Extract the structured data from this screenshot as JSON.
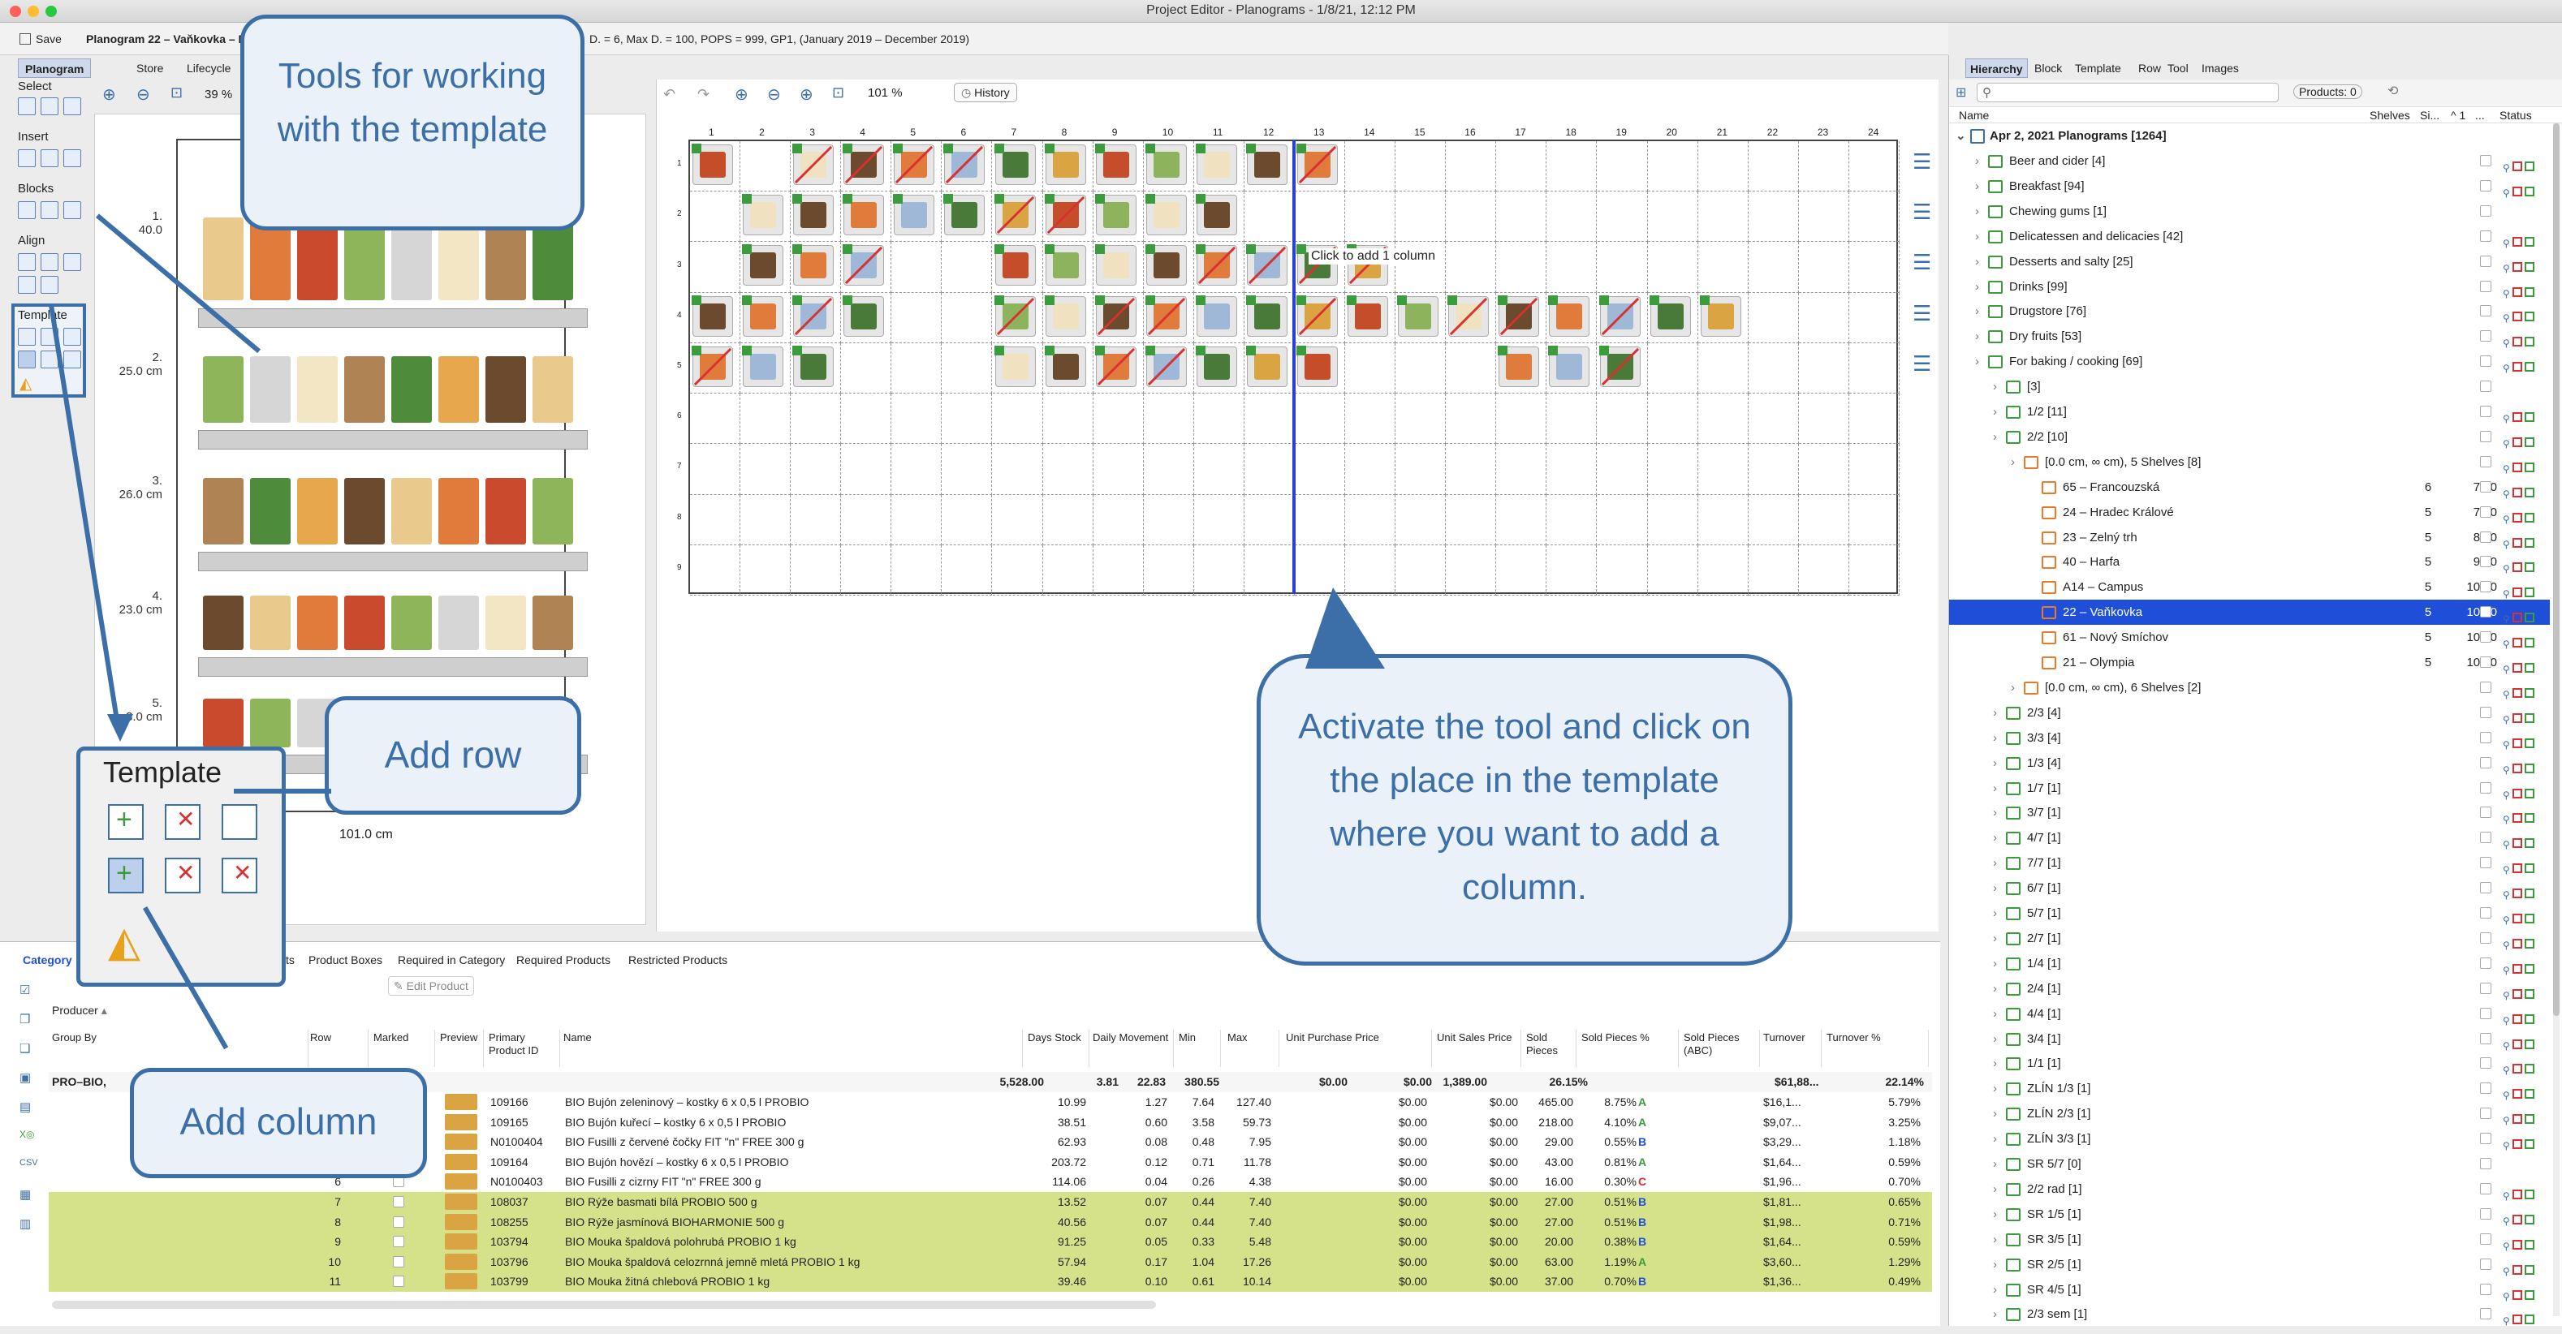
{
  "window": {
    "title": "Project Editor - Planograms - 1/8/21, 12:12 PM"
  },
  "toolbar": {
    "save_label": "Save",
    "planogram_info": "Planogram 22 – Vaňkovka – N",
    "planogram_extra": "D. = 6, Max D. = 100, POPS = 999, GP1, (January 2019 – December 2019)"
  },
  "left_tabs": [
    "Planogram",
    "Store",
    "Lifecycle"
  ],
  "tools": {
    "select": "Select",
    "insert": "Insert",
    "blocks": "Blocks",
    "align": "Align",
    "template": "Template"
  },
  "shelf_view": {
    "zoom": "39 %",
    "width_label": "101.0 cm",
    "shelves": [
      {
        "num": "1.",
        "height": "40.0"
      },
      {
        "num": "2.",
        "height": "25.0 cm"
      },
      {
        "num": "3.",
        "height": "26.0 cm"
      },
      {
        "num": "4.",
        "height": "23.0 cm"
      },
      {
        "num": "5.",
        "height": "3.0 cm"
      }
    ]
  },
  "grid_view": {
    "zoom": "101 %",
    "history_label": "History",
    "columns": [
      "1",
      "2",
      "3",
      "4",
      "5",
      "6",
      "7",
      "8",
      "9",
      "10",
      "11",
      "12",
      "13",
      "14",
      "15",
      "16",
      "17",
      "18",
      "19",
      "20",
      "21",
      "22",
      "23",
      "24"
    ],
    "rows": [
      "1",
      "2",
      "3",
      "4",
      "5",
      "6",
      "7",
      "8",
      "9"
    ],
    "tooltip": "Click to add 1 column"
  },
  "right_panel": {
    "tabs": [
      "Hierarchy",
      "Block",
      "Template",
      "Row",
      "Tool",
      "Images"
    ],
    "products_count": "Products: 0",
    "col_name": "Name",
    "col_shelves": "Shelves",
    "col_size": "Si...",
    "col_sort": "^ 1",
    "col_dots": "...",
    "col_status": "Status",
    "root": "Apr 2, 2021 Planograms [1264]",
    "items": [
      {
        "label": "Beer and cider [4]",
        "indent": 1,
        "type": "g",
        "status": true
      },
      {
        "label": "Breakfast [94]",
        "indent": 1,
        "type": "g",
        "status": true
      },
      {
        "label": "Chewing gums [1]",
        "indent": 1,
        "type": "g",
        "status": false
      },
      {
        "label": "Delicatessen and delicacies [42]",
        "indent": 1,
        "type": "g",
        "status": true
      },
      {
        "label": "Desserts and salty [25]",
        "indent": 1,
        "type": "g",
        "status": true
      },
      {
        "label": "Drinks [99]",
        "indent": 1,
        "type": "g",
        "status": true
      },
      {
        "label": "Drugstore [76]",
        "indent": 1,
        "type": "g",
        "status": true
      },
      {
        "label": "Dry fruits [53]",
        "indent": 1,
        "type": "g",
        "status": true
      },
      {
        "label": "For baking / cooking [69]",
        "indent": 1,
        "type": "g",
        "status": true
      },
      {
        "label": "[3]",
        "indent": 2,
        "type": "g",
        "status": false
      },
      {
        "label": "1/2 [11]",
        "indent": 2,
        "type": "g",
        "status": true
      },
      {
        "label": "2/2 [10]",
        "indent": 2,
        "type": "g",
        "status": true
      },
      {
        "label": "[0.0 cm, ∞ cm), 5 Shelves [8]",
        "indent": 3,
        "type": "o",
        "status": true
      },
      {
        "label": "65 – Francouzská",
        "indent": 4,
        "type": "o",
        "shelves": "6",
        "size": "70.0",
        "status": true
      },
      {
        "label": "24 – Hradec Králové",
        "indent": 4,
        "type": "o",
        "shelves": "5",
        "size": "72.0",
        "status": true
      },
      {
        "label": "23 – Zelný trh",
        "indent": 4,
        "type": "o",
        "shelves": "5",
        "size": "84.0",
        "status": true
      },
      {
        "label": "40 – Harfa",
        "indent": 4,
        "type": "o",
        "shelves": "5",
        "size": "94.0",
        "status": true
      },
      {
        "label": "A14 – Campus",
        "indent": 4,
        "type": "o",
        "shelves": "5",
        "size": "100.0",
        "status": true
      },
      {
        "label": "22 – Vaňkovka",
        "indent": 4,
        "type": "o",
        "shelves": "5",
        "size": "101.0",
        "status": true,
        "selected": true
      },
      {
        "label": "61 – Nový Smíchov",
        "indent": 4,
        "type": "o",
        "shelves": "5",
        "size": "105.0",
        "status": true
      },
      {
        "label": "21 – Olympia",
        "indent": 4,
        "type": "o",
        "shelves": "5",
        "size": "109.0",
        "status": true
      },
      {
        "label": "[0.0 cm, ∞ cm), 6 Shelves [2]",
        "indent": 3,
        "type": "o",
        "status": true
      },
      {
        "label": "2/3 [4]",
        "indent": 2,
        "type": "g",
        "status": true
      },
      {
        "label": "3/3 [4]",
        "indent": 2,
        "type": "g",
        "status": true
      },
      {
        "label": "1/3 [4]",
        "indent": 2,
        "type": "g",
        "status": true
      },
      {
        "label": "1/7 [1]",
        "indent": 2,
        "type": "g",
        "status": true
      },
      {
        "label": "3/7 [1]",
        "indent": 2,
        "type": "g",
        "status": true
      },
      {
        "label": "4/7 [1]",
        "indent": 2,
        "type": "g",
        "status": true
      },
      {
        "label": "7/7 [1]",
        "indent": 2,
        "type": "g",
        "status": true
      },
      {
        "label": "6/7 [1]",
        "indent": 2,
        "type": "g",
        "status": true
      },
      {
        "label": "5/7 [1]",
        "indent": 2,
        "type": "g",
        "status": true
      },
      {
        "label": "2/7 [1]",
        "indent": 2,
        "type": "g",
        "status": true
      },
      {
        "label": "1/4 [1]",
        "indent": 2,
        "type": "g",
        "status": true
      },
      {
        "label": "2/4 [1]",
        "indent": 2,
        "type": "g",
        "status": true
      },
      {
        "label": "4/4 [1]",
        "indent": 2,
        "type": "g",
        "status": true
      },
      {
        "label": "3/4 [1]",
        "indent": 2,
        "type": "g",
        "status": true
      },
      {
        "label": "1/1 [1]",
        "indent": 2,
        "type": "g",
        "status": true
      },
      {
        "label": "ZLÍN 1/3 [1]",
        "indent": 2,
        "type": "g",
        "status": true
      },
      {
        "label": "ZLÍN 2/3 [1]",
        "indent": 2,
        "type": "g",
        "status": true
      },
      {
        "label": "ZLÍN 3/3 [1]",
        "indent": 2,
        "type": "g",
        "status": true
      },
      {
        "label": "SR 5/7 [0]",
        "indent": 2,
        "type": "g",
        "status": false
      },
      {
        "label": "2/2 rad [1]",
        "indent": 2,
        "type": "g",
        "status": true
      },
      {
        "label": "SR 1/5 [1]",
        "indent": 2,
        "type": "g",
        "status": true
      },
      {
        "label": "SR 3/5 [1]",
        "indent": 2,
        "type": "g",
        "status": true
      },
      {
        "label": "SR 2/5 [1]",
        "indent": 2,
        "type": "g",
        "status": true
      },
      {
        "label": "SR 4/5 [1]",
        "indent": 2,
        "type": "g",
        "status": true
      },
      {
        "label": "2/3 sem [1]",
        "indent": 2,
        "type": "g",
        "status": true
      }
    ]
  },
  "bottom_panel": {
    "tabs": [
      "Category",
      "ts",
      "Product Boxes",
      "Required in Category",
      "Required Products",
      "Restricted Products"
    ],
    "edit_product": "Edit Product",
    "group_filter": "Producer",
    "headers": [
      "Group By",
      "Row",
      "Marked",
      "Preview",
      "Primary Product ID",
      "Name",
      "Days Stock",
      "Daily Movement",
      "Min",
      "Max",
      "Unit Purchase Price",
      "Unit Sales Price",
      "Sold Pieces",
      "Sold Pieces %",
      "Sold Pieces (ABC)",
      "Turnover",
      "Turnover %"
    ],
    "group_row": {
      "label": "PRO–BIO,",
      "days": "5,528.00",
      "daily": "3.81",
      "min": "22.83",
      "max": "380.55",
      "upp": "$0.00",
      "usp": "$0.00",
      "sold": "1,389.00",
      "soldp": "26.15%",
      "turn": "$61,88...",
      "turnp": "22.14%"
    },
    "rows": [
      {
        "row": "",
        "id": "109166",
        "name": "BIO Bujón zeleninový – kostky 6 x 0,5 l PROBIO",
        "days": "10.99",
        "daily": "1.27",
        "min": "7.64",
        "max": "127.40",
        "upp": "$0.00",
        "usp": "$0.00",
        "sold": "465.00",
        "soldp": "8.75%",
        "abc": "A",
        "turn": "$16,1...",
        "turnp": "5.79%",
        "green": false
      },
      {
        "row": "",
        "id": "109165",
        "name": "BIO Bujón kuřecí – kostky 6 x 0,5 l PROBIO",
        "days": "38.51",
        "daily": "0.60",
        "min": "3.58",
        "max": "59.73",
        "upp": "$0.00",
        "usp": "$0.00",
        "sold": "218.00",
        "soldp": "4.10%",
        "abc": "A",
        "turn": "$9,07...",
        "turnp": "3.25%",
        "green": false
      },
      {
        "row": "",
        "id": "N0100404",
        "name": "BIO Fusilli z červené čočky FIT \"n\" FREE 300 g",
        "days": "62.93",
        "daily": "0.08",
        "min": "0.48",
        "max": "7.95",
        "upp": "$0.00",
        "usp": "$0.00",
        "sold": "29.00",
        "soldp": "0.55%",
        "abc": "B",
        "turn": "$3,29...",
        "turnp": "1.18%",
        "green": false
      },
      {
        "row": "",
        "id": "109164",
        "name": "BIO Bujón hovězí – kostky 6 x 0,5 l PROBIO",
        "days": "203.72",
        "daily": "0.12",
        "min": "0.71",
        "max": "11.78",
        "upp": "$0.00",
        "usp": "$0.00",
        "sold": "43.00",
        "soldp": "0.81%",
        "abc": "A",
        "turn": "$1,64...",
        "turnp": "0.59%",
        "green": false
      },
      {
        "row": "6",
        "id": "N0100403",
        "name": "BIO Fusilli z cizrny FIT \"n\" FREE 300 g",
        "days": "114.06",
        "daily": "0.04",
        "min": "0.26",
        "max": "4.38",
        "upp": "$0.00",
        "usp": "$0.00",
        "sold": "16.00",
        "soldp": "0.30%",
        "abc": "C",
        "turn": "$1,96...",
        "turnp": "0.70%",
        "green": false
      },
      {
        "row": "7",
        "id": "108037",
        "name": "BIO Rýže basmati bílá PROBIO 500 g",
        "days": "13.52",
        "daily": "0.07",
        "min": "0.44",
        "max": "7.40",
        "upp": "$0.00",
        "usp": "$0.00",
        "sold": "27.00",
        "soldp": "0.51%",
        "abc": "B",
        "turn": "$1,81...",
        "turnp": "0.65%",
        "green": true
      },
      {
        "row": "8",
        "id": "108255",
        "name": "BIO Rýže jasmínová BIOHARMONIE 500 g",
        "days": "40.56",
        "daily": "0.07",
        "min": "0.44",
        "max": "7.40",
        "upp": "$0.00",
        "usp": "$0.00",
        "sold": "27.00",
        "soldp": "0.51%",
        "abc": "B",
        "turn": "$1,98...",
        "turnp": "0.71%",
        "green": true
      },
      {
        "row": "9",
        "id": "103794",
        "name": "BIO Mouka špaldová polohrubá PROBIO 1 kg",
        "days": "91.25",
        "daily": "0.05",
        "min": "0.33",
        "max": "5.48",
        "upp": "$0.00",
        "usp": "$0.00",
        "sold": "20.00",
        "soldp": "0.38%",
        "abc": "B",
        "turn": "$1,64...",
        "turnp": "0.59%",
        "green": true
      },
      {
        "row": "10",
        "id": "103796",
        "name": "BIO Mouka špaldová celozrnná jemně mletá PROBIO 1 kg",
        "days": "57.94",
        "daily": "0.17",
        "min": "1.04",
        "max": "17.26",
        "upp": "$0.00",
        "usp": "$0.00",
        "sold": "63.00",
        "soldp": "1.19%",
        "abc": "A",
        "turn": "$3,60...",
        "turnp": "1.29%",
        "green": true
      },
      {
        "row": "11",
        "id": "103799",
        "name": "BIO Mouka žitná chlebová PROBIO 1 kg",
        "days": "39.46",
        "daily": "0.10",
        "min": "0.61",
        "max": "10.14",
        "upp": "$0.00",
        "usp": "$0.00",
        "sold": "37.00",
        "soldp": "0.70%",
        "abc": "B",
        "turn": "$1,36...",
        "turnp": "0.49%",
        "green": true
      }
    ]
  },
  "callouts": {
    "tools": "Tools for working with the template",
    "template_box_title": "Template",
    "add_row": "Add row",
    "add_column": "Add column",
    "activate": "Activate the tool and click on the place in the template where you want to add a column."
  },
  "colors": {
    "accent": "#3c6fa8",
    "selection": "#1f4fd8",
    "highlight_row": "#d5e28a",
    "status_green": "#3c9b3c",
    "status_red": "#d93030",
    "grid_insert_line": "#2a3fd8"
  }
}
